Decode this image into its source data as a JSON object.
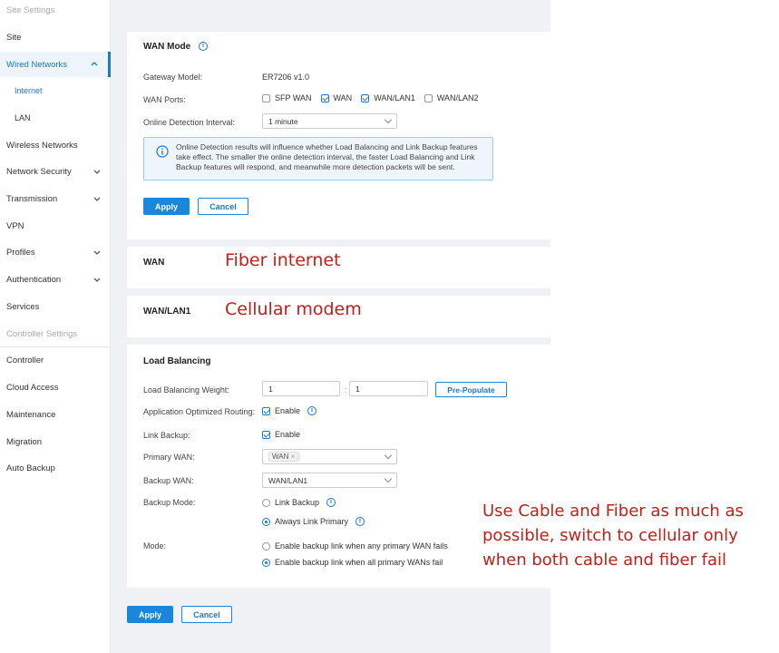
{
  "sidebar": {
    "items": [
      {
        "label": "Site Settings"
      },
      {
        "label": "Site"
      },
      {
        "label": "Wired Networks"
      },
      {
        "label": "Internet"
      },
      {
        "label": "LAN"
      },
      {
        "label": "Wireless Networks"
      },
      {
        "label": "Network Security"
      },
      {
        "label": "Transmission"
      },
      {
        "label": "VPN"
      },
      {
        "label": "Profiles"
      },
      {
        "label": "Authentication"
      },
      {
        "label": "Services"
      },
      {
        "label": "Controller Settings"
      },
      {
        "label": "Controller"
      },
      {
        "label": "Cloud Access"
      },
      {
        "label": "Maintenance"
      },
      {
        "label": "Migration"
      },
      {
        "label": "Auto Backup"
      }
    ]
  },
  "wan_mode": {
    "title": "WAN Mode",
    "gateway_model_label": "Gateway Model:",
    "gateway_model_value": "ER7206 v1.0",
    "wan_ports_label": "WAN Ports:",
    "ports": [
      {
        "label": "SFP WAN",
        "checked": false
      },
      {
        "label": "WAN",
        "checked": true
      },
      {
        "label": "WAN/LAN1",
        "checked": true
      },
      {
        "label": "WAN/LAN2",
        "checked": false
      }
    ],
    "detection_label": "Online Detection Interval:",
    "detection_value": "1 minute",
    "notice": "Online Detection results will influence whether Load Balancing and Link Backup features take effect. The smaller the online detection interval, the faster Load Balancing and Link Backup features will respond, and meanwhile more detection packets will be sent.",
    "apply_label": "Apply",
    "cancel_label": "Cancel"
  },
  "wan_section": {
    "title": "WAN"
  },
  "wan_lan1_section": {
    "title": "WAN/LAN1"
  },
  "load_balancing": {
    "title": "Load Balancing",
    "weight_label": "Load Balancing Weight:",
    "weight_1": "1",
    "weight_sep": ":",
    "weight_2": "1",
    "prepopulate_label": "Pre-Populate",
    "app_routing_label": "Application Optimized Routing:",
    "app_routing_enable": "Enable",
    "link_backup_label": "Link Backup:",
    "link_backup_enable": "Enable",
    "primary_wan_label": "Primary WAN:",
    "primary_wan_tag": "WAN",
    "backup_wan_label": "Backup WAN:",
    "backup_wan_value": "WAN/LAN1",
    "backup_mode_label": "Backup Mode:",
    "backup_mode_options": [
      {
        "label": "Link Backup",
        "selected": false
      },
      {
        "label": "Always Link Primary",
        "selected": true
      }
    ],
    "mode_label": "Mode:",
    "mode_options": [
      {
        "label": "Enable backup link when any primary WAN fails",
        "selected": false
      },
      {
        "label": "Enable backup link when all primary WANs fail",
        "selected": true
      }
    ]
  },
  "footer": {
    "apply_label": "Apply",
    "cancel_label": "Cancel"
  },
  "annotations": {
    "fiber": "Fiber internet",
    "cellular": "Cellular modem",
    "note_line1": "Use Cable and Fiber as much as",
    "note_line2": "possible, switch to cellular only",
    "note_line3": "when both cable and fiber fail"
  },
  "colors": {
    "accent": "#1a87dc",
    "annotation": "#c0201a"
  }
}
